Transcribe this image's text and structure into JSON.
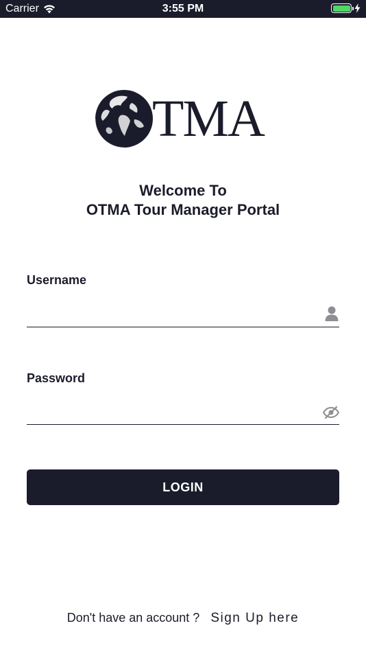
{
  "status_bar": {
    "carrier": "Carrier",
    "time": "3:55 PM",
    "battery_color": "#4cd964"
  },
  "logo": {
    "text": "TMA",
    "icon": "globe-icon"
  },
  "welcome": {
    "line1": "Welcome To",
    "line2": "OTMA Tour Manager Portal"
  },
  "form": {
    "username": {
      "label": "Username",
      "value": "",
      "icon": "user-icon"
    },
    "password": {
      "label": "Password",
      "value": "",
      "icon": "eye-slash-icon"
    },
    "login_label": "LOGIN"
  },
  "footer": {
    "prompt": "Don't have an account ?",
    "signup_label": "Sign Up here"
  },
  "colors": {
    "primary": "#1b1c2b",
    "background": "#ffffff",
    "icon_gray": "#8e8e93"
  }
}
